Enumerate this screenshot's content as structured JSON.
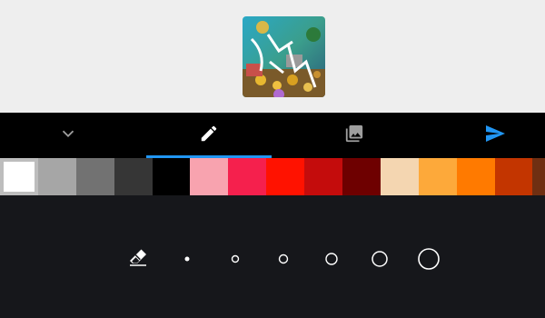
{
  "app": {
    "screen": "image-annotation-editor"
  },
  "toolbar": {
    "items": [
      {
        "name": "collapse",
        "icon": "chevron-down-icon",
        "active": false
      },
      {
        "name": "draw",
        "icon": "pencil-icon",
        "active": true
      },
      {
        "name": "gallery",
        "icon": "photo-library-icon",
        "active": false
      },
      {
        "name": "send",
        "icon": "send-icon",
        "active": false
      }
    ],
    "accent": "#2196f3"
  },
  "palette": {
    "colors": [
      "#ffffff",
      "#a6a6a6",
      "#727272",
      "#363636",
      "#000000",
      "#f8a3af",
      "#f5204d",
      "#ff1200",
      "#c40c0c",
      "#6e0000",
      "#f4d6b1",
      "#fda93a",
      "#ff7a00",
      "#c33500",
      "#6f2f12"
    ],
    "selected_index": 0
  },
  "brush": {
    "tools": [
      "eraser-icon"
    ],
    "sizes": [
      "xs",
      "s",
      "m",
      "l",
      "xl",
      "xxl"
    ],
    "selected_size": null
  }
}
